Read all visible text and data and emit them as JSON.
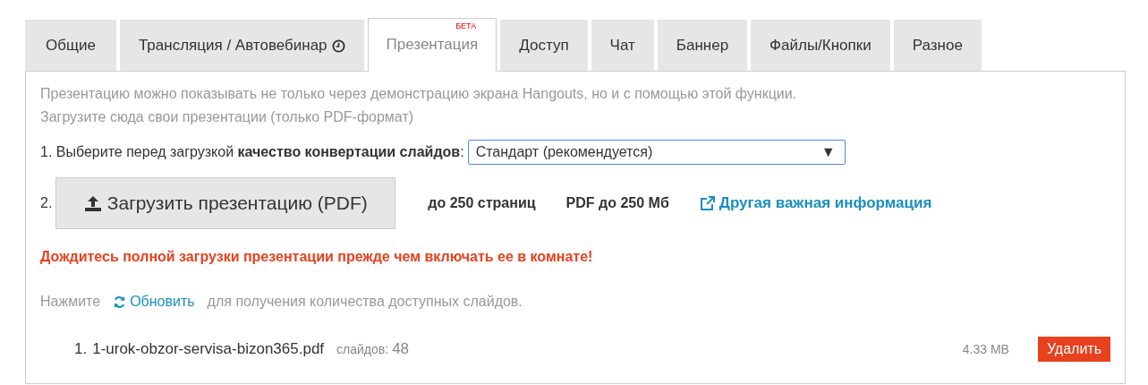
{
  "tabs": [
    {
      "label": "Общие",
      "selected": false
    },
    {
      "label": "Трансляция / Автовебинар",
      "selected": false,
      "clock": true
    },
    {
      "label": "Презентация",
      "selected": true,
      "badge": "БЕТА"
    },
    {
      "label": "Доступ",
      "selected": false
    },
    {
      "label": "Чат",
      "selected": false
    },
    {
      "label": "Баннер",
      "selected": false
    },
    {
      "label": "Файлы/Кнопки",
      "selected": false
    },
    {
      "label": "Разное",
      "selected": false
    }
  ],
  "intro": [
    "Презентацию можно показывать не только через демонстрацию экрана Hangouts, но и с помощью этой функции.",
    "Загрузите сюда свои презентации (только PDF-формат)"
  ],
  "step1": {
    "label": "1. Выберите перед загрузкой **качество конвертации слайдов**:",
    "select": {
      "value": "Стандарт (рекомендуется)",
      "arrow": "▼"
    }
  },
  "step2": {
    "number": "2.",
    "upload_button": "Загрузить презентацию (PDF)",
    "pages_limit": "до 250 страниц",
    "size_limit": "PDF до 250 Мб",
    "info_link": "Другая важная информация"
  },
  "warning": "Дождитесь полной загрузки презентации прежде чем включать ее в комнате!",
  "refresh_line": {
    "before": "Нажмите",
    "link": "Обновить",
    "after": "для получения количества доступных слайдов."
  },
  "files": [
    {
      "number": "1.",
      "name": "1-urok-obzor-servisa-bizon365.pdf",
      "slides_label": "слайдов:",
      "slides": "48",
      "size": "4.33 MB",
      "delete_button": "Удалить"
    }
  ]
}
